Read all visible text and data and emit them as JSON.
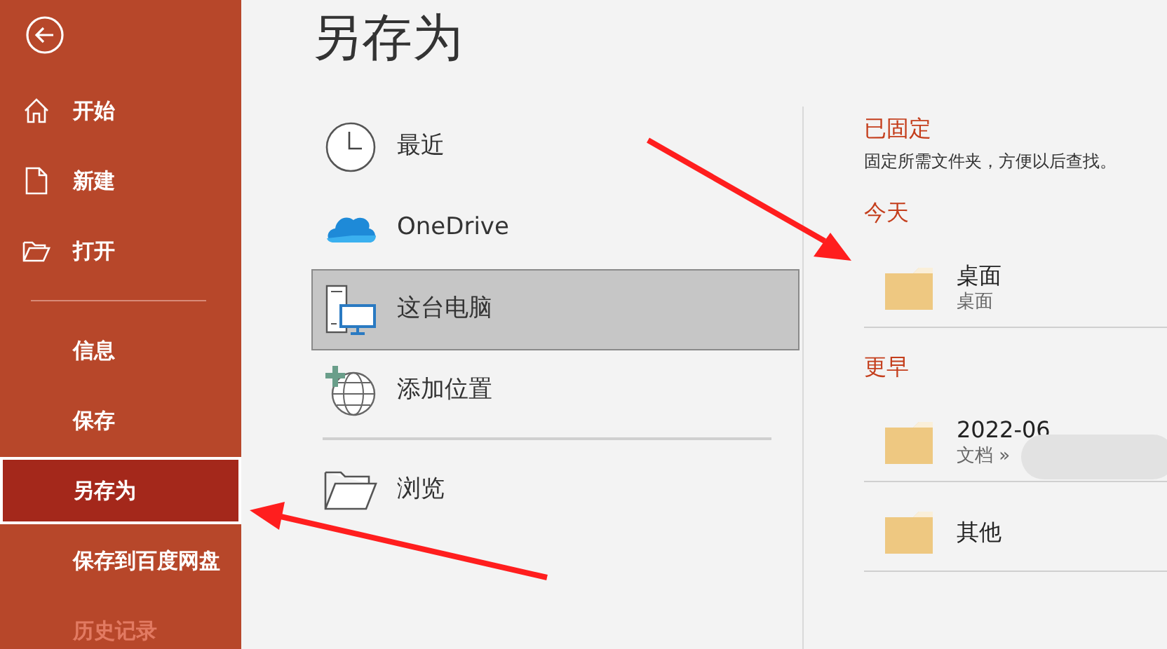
{
  "sidebar": {
    "items": [
      {
        "label": "开始",
        "kind": "home",
        "selected": false,
        "disabled": false
      },
      {
        "label": "新建",
        "kind": "new",
        "selected": false,
        "disabled": false
      },
      {
        "label": "打开",
        "kind": "open",
        "selected": false,
        "disabled": false
      },
      {
        "kind": "divider"
      },
      {
        "label": "信息",
        "kind": "text",
        "selected": false,
        "disabled": false
      },
      {
        "label": "保存",
        "kind": "text",
        "selected": false,
        "disabled": false
      },
      {
        "label": "另存为",
        "kind": "text",
        "selected": true,
        "disabled": false
      },
      {
        "label": "保存到百度网盘",
        "kind": "text",
        "selected": false,
        "disabled": false
      },
      {
        "label": "历史记录",
        "kind": "text",
        "selected": false,
        "disabled": true
      }
    ]
  },
  "title": "另存为",
  "locations": [
    {
      "label": "最近",
      "kind": "recent",
      "selected": false
    },
    {
      "label": "OneDrive",
      "kind": "cloud",
      "selected": false
    },
    {
      "label": "这台电脑",
      "kind": "pc",
      "selected": true
    },
    {
      "label": "添加位置",
      "kind": "add",
      "selected": false
    },
    {
      "kind": "divider"
    },
    {
      "label": "浏览",
      "kind": "browse",
      "selected": false
    }
  ],
  "folders": {
    "sections": [
      {
        "heading": "已固定",
        "description": "固定所需文件夹，方便以后查找。"
      },
      {
        "heading": "今天",
        "items": [
          {
            "name": "桌面",
            "path": "桌面"
          }
        ]
      },
      {
        "heading": "更早",
        "items": [
          {
            "name": "2022-06",
            "path": "文档 »",
            "blurred": true
          },
          {
            "name": "其他"
          }
        ]
      }
    ]
  }
}
